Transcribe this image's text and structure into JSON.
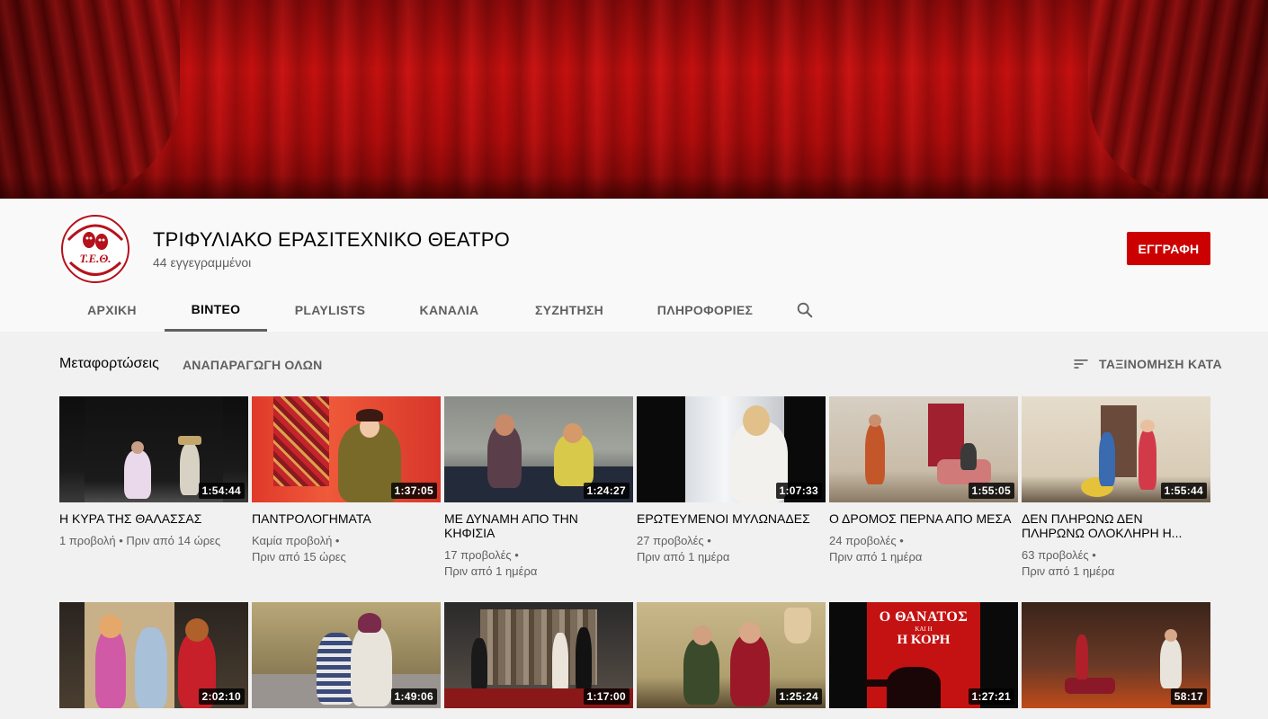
{
  "channel": {
    "name": "ΤΡΙΦΥΛΙΑΚΟ ΕΡΑΣΙΤΕΧΝΙΚΟ ΘΕΑΤΡΟ",
    "subscribers": "44 εγγεγραμμένοι",
    "logo_text": "Τ.Ε.Θ.",
    "subscribe_label": "ΕΓΓΡΑΦΗ"
  },
  "tabs": [
    {
      "label": "ΑΡΧΙΚΗ"
    },
    {
      "label": "ΒΙΝΤΕΟ"
    },
    {
      "label": "PLAYLISTS"
    },
    {
      "label": "ΚΑΝΑΛΙΑ"
    },
    {
      "label": "ΣΥΖΗΤΗΣΗ"
    },
    {
      "label": "ΠΛΗΡΟΦΟΡΙΕΣ"
    }
  ],
  "active_tab": "ΒΙΝΤΕΟ",
  "section": {
    "title": "Μεταφορτώσεις",
    "play_all": "ΑΝΑΠΑΡΑΓΩΓΗ ΟΛΩΝ",
    "sort_label": "ΤΑΞΙΝΟΜΗΣΗ ΚΑΤΑ"
  },
  "videos": [
    {
      "title": "Η ΚΥΡΑ ΤΗΣ ΘΑΛΑΣΣΑΣ",
      "duration": "1:54:44",
      "meta1": "1 προβολή • Πριν από 14 ώρες",
      "meta2": ""
    },
    {
      "title": "ΠΑΝΤΡΟΛΟΓΗΜΑΤΑ",
      "duration": "1:37:05",
      "meta1": "Καμία προβολή •",
      "meta2": "Πριν από 15 ώρες"
    },
    {
      "title": "ΜΕ ΔΥΝΑΜΗ ΑΠΟ ΤΗΝ ΚΗΦΙΣΙΑ",
      "duration": "1:24:27",
      "meta1": "17 προβολές •",
      "meta2": "Πριν από 1 ημέρα"
    },
    {
      "title": "ΕΡΩΤΕΥΜΕΝΟΙ ΜΥΛΩΝΑΔΕΣ",
      "duration": "1:07:33",
      "meta1": "27 προβολές •",
      "meta2": "Πριν από 1 ημέρα"
    },
    {
      "title": "Ο ΔΡΟΜΟΣ ΠΕΡΝΑ ΑΠΟ ΜΕΣΑ",
      "duration": "1:55:05",
      "meta1": "24 προβολές •",
      "meta2": "Πριν από 1 ημέρα"
    },
    {
      "title": "ΔΕΝ ΠΛΗΡΩΝΩ ΔΕΝ ΠΛΗΡΩΝΩ ΟΛΟΚΛΗΡΗ Η...",
      "duration": "1:55:44",
      "meta1": "63 προβολές •",
      "meta2": "Πριν από 1 ημέρα"
    },
    {
      "title": "",
      "duration": "2:02:10",
      "meta1": "",
      "meta2": ""
    },
    {
      "title": "",
      "duration": "1:49:06",
      "meta1": "",
      "meta2": ""
    },
    {
      "title": "",
      "duration": "1:17:00",
      "meta1": "",
      "meta2": ""
    },
    {
      "title": "",
      "duration": "1:25:24",
      "meta1": "",
      "meta2": ""
    },
    {
      "title": "",
      "duration": "1:27:21",
      "meta1": "",
      "meta2": "",
      "thumb_text": [
        "Ο ΘΑΝΑΤΟΣ",
        "ΚΑΙ Η",
        "Η ΚΟΡΗ"
      ]
    },
    {
      "title": "",
      "duration": "58:17",
      "meta1": "",
      "meta2": ""
    }
  ],
  "colors": {
    "subscribe": "#cc0000",
    "banner": "#b00c0c",
    "background": "#f1f1f1"
  },
  "icons": {
    "search": "search-icon",
    "sort": "sort-icon"
  }
}
